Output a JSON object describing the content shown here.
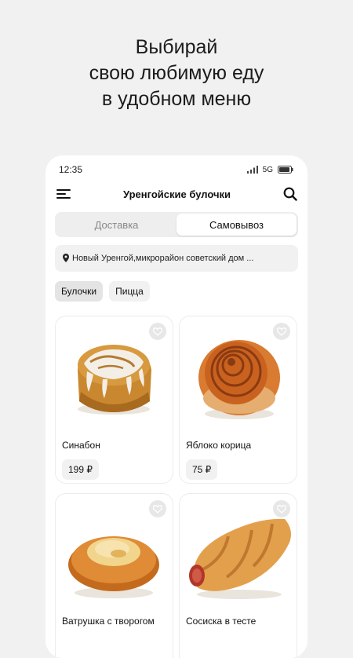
{
  "headline": {
    "line1": "Выбирай",
    "line2": "свою любимую еду",
    "line3": "в удобном меню"
  },
  "status_bar": {
    "time": "12:35",
    "network": "5G"
  },
  "app_bar": {
    "title": "Уренгойские булочки",
    "menu_icon": "hamburger-menu-icon",
    "search_icon": "search-icon"
  },
  "delivery_mode": {
    "options": [
      "Доставка",
      "Самовывоз"
    ],
    "selected": "Самовывоз"
  },
  "address": {
    "text": "Новый Уренгой,микрорайон советский дом ...",
    "icon": "location-pin-icon"
  },
  "categories": {
    "items": [
      "Булочки",
      "Пицца"
    ],
    "selected": "Булочки"
  },
  "products": [
    {
      "name": "Синабон",
      "price": "199 ₽"
    },
    {
      "name": "Яблоко корица",
      "price": "75 ₽"
    },
    {
      "name": "Ватрушка с творогом",
      "price": ""
    },
    {
      "name": "Сосиска в тесте",
      "price": ""
    }
  ],
  "colors": {
    "background": "#f1f1f1",
    "card": "#ffffff",
    "text": "#111111",
    "muted": "#888888"
  }
}
